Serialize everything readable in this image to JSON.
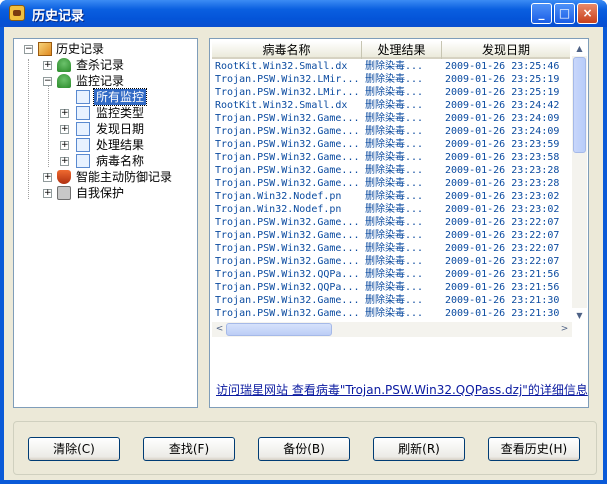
{
  "window": {
    "title": "历史记录",
    "controls": {
      "minimize": "_",
      "maximize": "□",
      "close": "×"
    }
  },
  "tree": {
    "root": {
      "label": "历史记录",
      "expander": "−"
    },
    "items": [
      {
        "label": "查杀记录",
        "expander": "+"
      },
      {
        "label": "监控记录",
        "expander": "−"
      },
      {
        "label": "所有监控"
      },
      {
        "label": "监控类型",
        "expander": "+"
      },
      {
        "label": "发现日期",
        "expander": "+"
      },
      {
        "label": "处理结果",
        "expander": "+"
      },
      {
        "label": "病毒名称",
        "expander": "+"
      },
      {
        "label": "智能主动防御记录",
        "expander": "+"
      },
      {
        "label": "自我保护",
        "expander": "+"
      }
    ]
  },
  "list": {
    "columns": [
      "病毒名称",
      "处理结果",
      "发现日期"
    ],
    "rows": [
      [
        "RootKit.Win32.Small.dx",
        "删除染毒...",
        "2009-01-26 23:25:46"
      ],
      [
        "Trojan.PSW.Win32.LMir...",
        "删除染毒...",
        "2009-01-26 23:25:19"
      ],
      [
        "Trojan.PSW.Win32.LMir...",
        "删除染毒...",
        "2009-01-26 23:25:19"
      ],
      [
        "RootKit.Win32.Small.dx",
        "删除染毒...",
        "2009-01-26 23:24:42"
      ],
      [
        "Trojan.PSW.Win32.Game...",
        "删除染毒...",
        "2009-01-26 23:24:09"
      ],
      [
        "Trojan.PSW.Win32.Game...",
        "删除染毒...",
        "2009-01-26 23:24:09"
      ],
      [
        "Trojan.PSW.Win32.Game...",
        "删除染毒...",
        "2009-01-26 23:23:59"
      ],
      [
        "Trojan.PSW.Win32.Game...",
        "删除染毒...",
        "2009-01-26 23:23:58"
      ],
      [
        "Trojan.PSW.Win32.Game...",
        "删除染毒...",
        "2009-01-26 23:23:28"
      ],
      [
        "Trojan.PSW.Win32.Game...",
        "删除染毒...",
        "2009-01-26 23:23:28"
      ],
      [
        "Trojan.Win32.Nodef.pn",
        "删除染毒...",
        "2009-01-26 23:23:02"
      ],
      [
        "Trojan.Win32.Nodef.pn",
        "删除染毒...",
        "2009-01-26 23:23:02"
      ],
      [
        "Trojan.PSW.Win32.Game...",
        "删除染毒...",
        "2009-01-26 23:22:07"
      ],
      [
        "Trojan.PSW.Win32.Game...",
        "删除染毒...",
        "2009-01-26 23:22:07"
      ],
      [
        "Trojan.PSW.Win32.Game...",
        "删除染毒...",
        "2009-01-26 23:22:07"
      ],
      [
        "Trojan.PSW.Win32.Game...",
        "删除染毒...",
        "2009-01-26 23:22:07"
      ],
      [
        "Trojan.PSW.Win32.QQPa...",
        "删除染毒...",
        "2009-01-26 23:21:56"
      ],
      [
        "Trojan.PSW.Win32.QQPa...",
        "删除染毒...",
        "2009-01-26 23:21:56"
      ],
      [
        "Trojan.PSW.Win32.Game...",
        "删除染毒...",
        "2009-01-26 23:21:30"
      ],
      [
        "Trojan.PSW.Win32.Game...",
        "删除染毒...",
        "2009-01-26 23:21:30"
      ]
    ]
  },
  "scrollbars": {
    "up": "▲",
    "down": "▼",
    "left": "<",
    "right": ">"
  },
  "info_link": "访问瑞星网站 查看病毒\"Trojan.PSW.Win32.QQPass.dzj\"的详细信息",
  "buttons": {
    "clear": "清除(C)",
    "find": "查找(F)",
    "backup": "备份(B)",
    "refresh": "刷新(R)",
    "view_history": "查看历史(H)"
  }
}
